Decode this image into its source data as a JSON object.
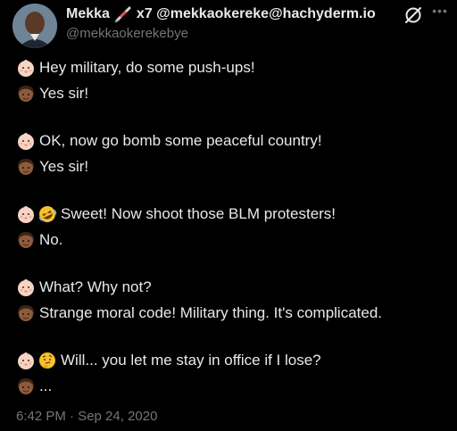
{
  "author": {
    "name": "Mekka",
    "name_suffix": "x7 @mekkaokereke@hachyderm.io",
    "handle": "@mekkaokerekebye"
  },
  "lines": [
    {
      "emojis": [
        "baby-face-light"
      ],
      "text": "Hey military, do some push-ups!"
    },
    {
      "emojis": [
        "man-face-medium-dark"
      ],
      "text": "Yes sir!"
    },
    {
      "emojis": [
        "baby-face-light"
      ],
      "text": " OK, now go bomb some peaceful country!"
    },
    {
      "emojis": [
        "man-face-medium-dark"
      ],
      "text": "Yes sir!"
    },
    {
      "emojis": [
        "baby-face-light",
        "rolling-laughing"
      ],
      "text": "Sweet! Now shoot those BLM protesters!"
    },
    {
      "emojis": [
        "man-face-medium-dark"
      ],
      "text": "No."
    },
    {
      "emojis": [
        "baby-face-light"
      ],
      "text": "What? Why not?"
    },
    {
      "emojis": [
        "man-face-medium-dark"
      ],
      "text": "Strange moral code! Military thing. It's complicated."
    },
    {
      "emojis": [
        "baby-face-light",
        "thinking-face"
      ],
      "text": "Will... you let me stay in office if I lose?"
    },
    {
      "emojis": [
        "man-face-medium-dark"
      ],
      "text": "..."
    }
  ],
  "timestamp": "6:42 PM · Sep 24, 2020",
  "colors": {
    "background": "#000000",
    "text": "#e7e9ea",
    "muted": "#71767b"
  }
}
